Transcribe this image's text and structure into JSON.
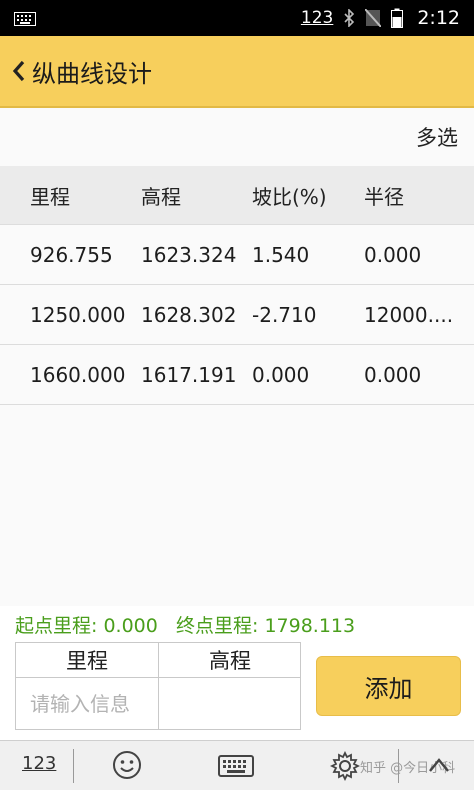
{
  "status_bar": {
    "input_method": "123",
    "time": "2:12",
    "icons": [
      "keyboard-icon",
      "bluetooth-icon",
      "no-sim-icon",
      "battery-icon"
    ]
  },
  "app_bar": {
    "title": "纵曲线设计",
    "back_icon": "chevron-left-icon"
  },
  "toolbar": {
    "multi_select": "多选"
  },
  "table": {
    "columns": [
      "里程",
      "高程",
      "坡比(%)",
      "半径"
    ],
    "rows": [
      [
        "926.755",
        "1623.324",
        "1.540",
        "0.000"
      ],
      [
        "1250.000",
        "1628.302",
        "-2.710",
        "12000...."
      ],
      [
        "1660.000",
        "1617.191",
        "0.000",
        "0.000"
      ]
    ]
  },
  "range": {
    "start": "起点里程: 0.000",
    "end": "终点里程: 1798.113"
  },
  "input_form": {
    "col_mileage": "里程",
    "col_elevation": "高程",
    "mileage_placeholder": "请输入信息",
    "elevation_value": "",
    "add_label": "添加"
  },
  "keyboard_toolbar": {
    "numeric_label": "123",
    "watermark": "知乎 @今日小科"
  },
  "colors": {
    "accent": "#f7cf5c",
    "range_text": "#4a9e1c",
    "status_bar": "#000000"
  }
}
